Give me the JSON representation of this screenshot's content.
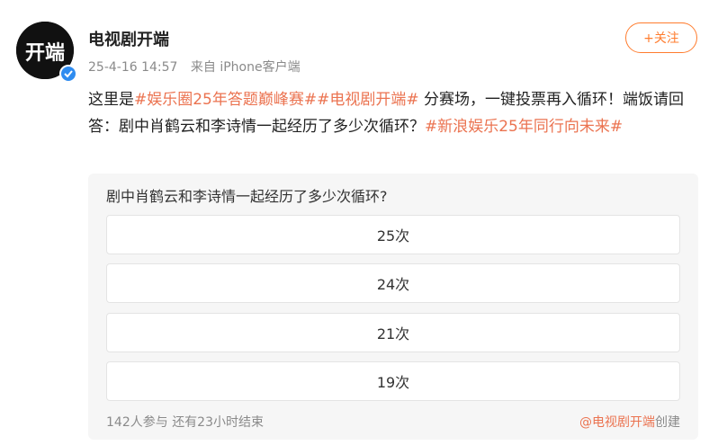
{
  "account": {
    "name": "电视剧开端",
    "avatar_text": "开端",
    "timestamp": "25-4-16 14:57",
    "source": "来自 iPhone客户端"
  },
  "follow_button": {
    "label": "+关注"
  },
  "post": {
    "prefix": "这里是",
    "tag1": "#娱乐圈25年答题巅峰赛#",
    "tag2": "#电视剧开端#",
    "middle": " 分赛场，一键投票再入循环！端饭请回答：剧中肖鹤云和李诗情一起经历了多少次循环？",
    "tag3": "#新浪娱乐25年同行向未来#"
  },
  "poll": {
    "question": "剧中肖鹤云和李诗情一起经历了多少次循环?",
    "options": [
      "25次",
      "24次",
      "21次",
      "19次"
    ],
    "participants": "142人参与",
    "remaining": "还有23小时结束",
    "creator_handle": "@电视剧开端",
    "creator_suffix": "创建"
  },
  "colors": {
    "accent": "#ff7c2e",
    "tag": "#eb7350",
    "verified": "#2f8cf0"
  }
}
